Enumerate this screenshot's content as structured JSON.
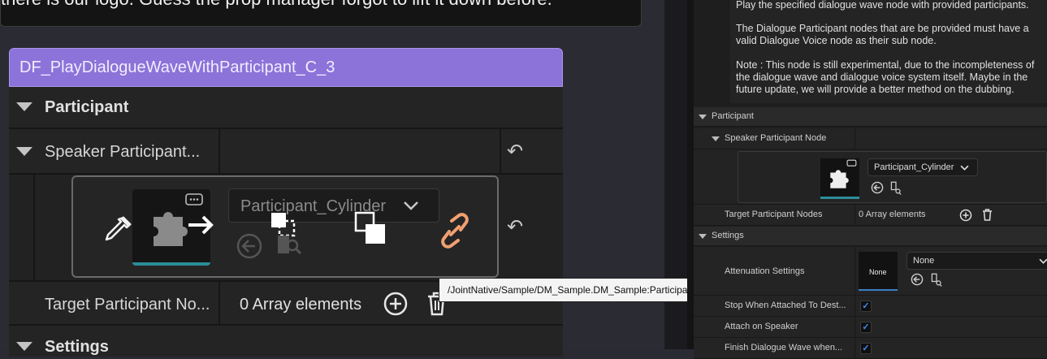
{
  "banner_text": "there is our logo. Guess the prop manager forgot to lift it down before.",
  "node": {
    "title": "DF_PlayDialogueWaveWithParticipant_C_3",
    "section_participant": "Participant",
    "speaker_label": "Speaker Participant...",
    "asset_value": "Participant_Cylinder",
    "target_label": "Target Participant No...",
    "target_value": "0 Array elements",
    "section_settings": "Settings"
  },
  "tooltip": "/JointNative/Sample/DM_Sample.DM_Sample:Participant_Cylinder",
  "details": {
    "description": [
      "Play the specified dialogue wave node with provided participants.",
      "The Dialogue Participant nodes that are be provided must have a valid Dialogue Voice node as their sub node.",
      "Note : This node is still experimental, due to the incompleteness of the dialogue wave and dialogue voice system itself. Maybe in the future update, we will provide a better method on the dubbing."
    ],
    "participant_header": "Participant",
    "speaker_label": "Speaker Participant Node",
    "asset_value": "Participant_Cylinder",
    "target_label": "Target Participant Nodes",
    "target_value": "0 Array elements",
    "settings_header": "Settings",
    "attenuation_label": "Attenuation Settings",
    "attenuation_thumb": "None",
    "attenuation_value": "None",
    "stop_label": "Stop When Attached To Dest...",
    "attach_label": "Attach on Speaker",
    "finish_label": "Finish Dialogue Wave when..."
  },
  "colors": {
    "node_header": "#8b73d9",
    "thumb_accent": "#2c8d99",
    "link_icon": "#f0a070",
    "checkbox": "#3e8df5"
  }
}
